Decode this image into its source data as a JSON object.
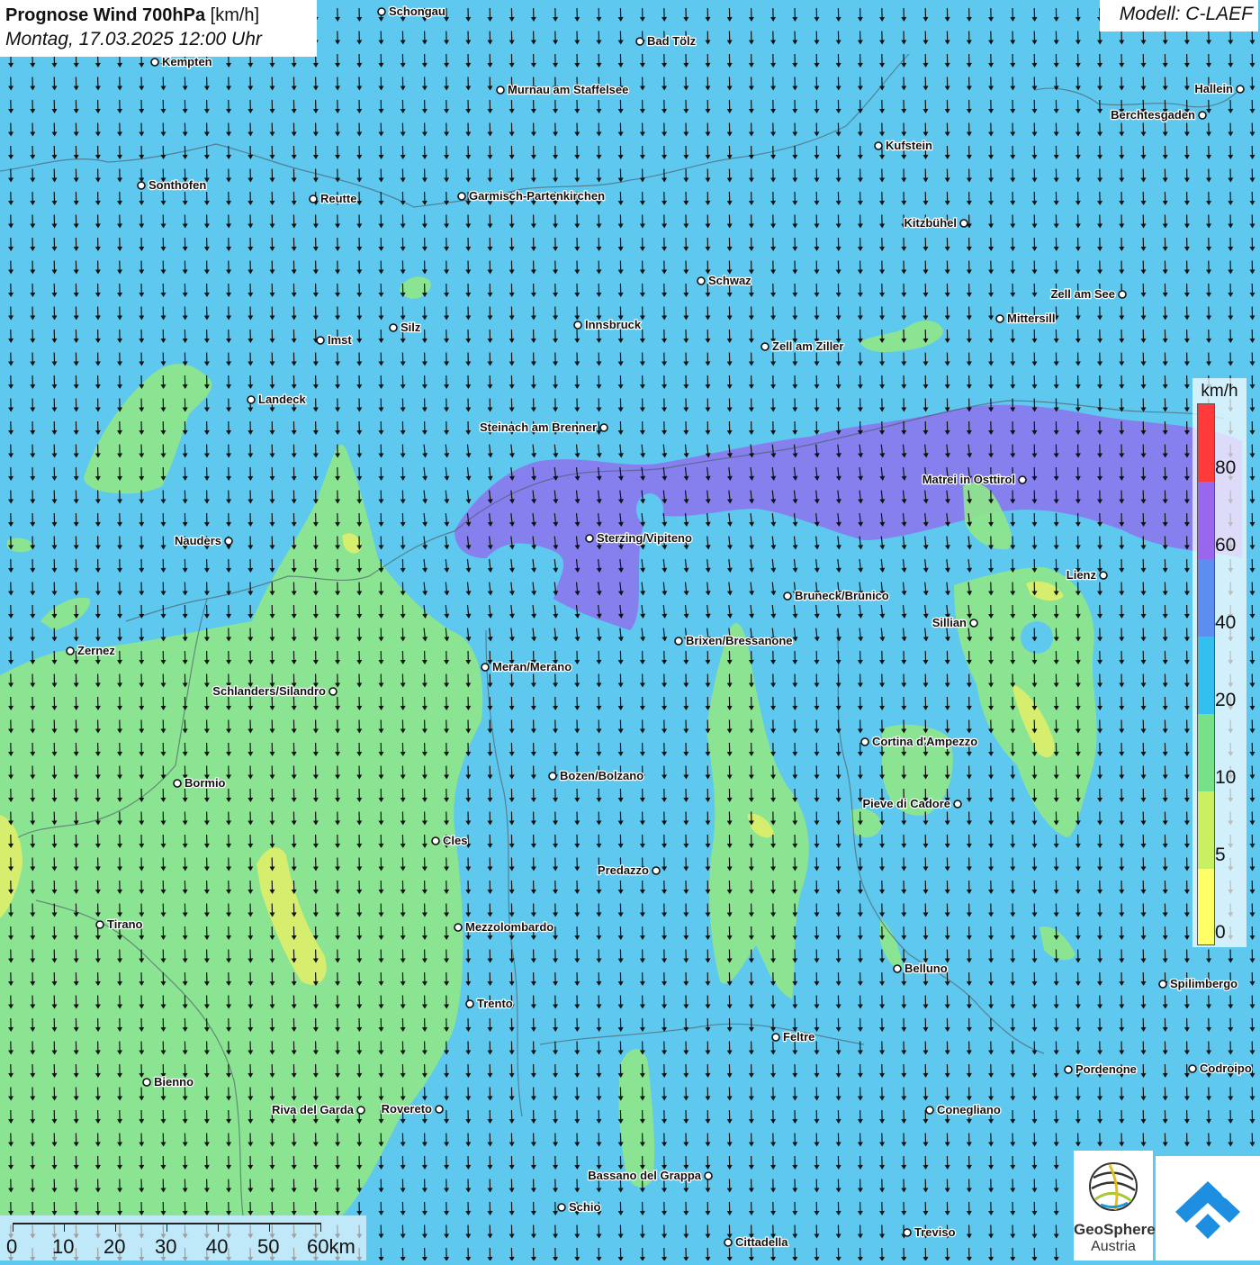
{
  "title": {
    "main": "Prognose Wind 700hPa",
    "unit": "[km/h]",
    "datetime": "Montag, 17.03.2025 12:00 Uhr"
  },
  "model": "Modell: C-LAEF",
  "legend": {
    "unit": "km/h",
    "labels": [
      "80",
      "60",
      "40",
      "20",
      "10",
      "5",
      "0"
    ],
    "colors": [
      "#ff3a3a",
      "#9966ee",
      "#5b8ef0",
      "#33c0ee",
      "#77e088",
      "#c8f060",
      "#ffff66"
    ]
  },
  "scale": {
    "labels": [
      "0",
      "10",
      "20",
      "30",
      "40",
      "50",
      "60km"
    ]
  },
  "logos": {
    "brand": "GeoSphere",
    "brand_sub": "Austria"
  },
  "cities": [
    {
      "name": "Schongau"
    },
    {
      "name": "Bad Tölz"
    },
    {
      "name": "Kempten"
    },
    {
      "name": "Murnau am Staffelsee"
    },
    {
      "name": "Hallein"
    },
    {
      "name": "Berchtesgaden"
    },
    {
      "name": "Kufstein"
    },
    {
      "name": "Sonthofen"
    },
    {
      "name": "Reutte"
    },
    {
      "name": "Garmisch-Partenkirchen"
    },
    {
      "name": "Kitzbühel"
    },
    {
      "name": "Schwaz"
    },
    {
      "name": "Zell am See"
    },
    {
      "name": "Mittersill"
    },
    {
      "name": "Innsbruck"
    },
    {
      "name": "Silz"
    },
    {
      "name": "Imst"
    },
    {
      "name": "Zell am Ziller"
    },
    {
      "name": "Landeck"
    },
    {
      "name": "Steinach am Brenner"
    },
    {
      "name": "Matrei in Osttirol"
    },
    {
      "name": "Nauders"
    },
    {
      "name": "Sterzing/Vipiteno"
    },
    {
      "name": "Lienz"
    },
    {
      "name": "Bruneck/Brunico"
    },
    {
      "name": "Sillian"
    },
    {
      "name": "Brixen/Bressanone"
    },
    {
      "name": "Zernez"
    },
    {
      "name": "Meran/Merano"
    },
    {
      "name": "Schlanders/Silandro"
    },
    {
      "name": "Cortina d'Ampezzo"
    },
    {
      "name": "Bozen/Bolzano"
    },
    {
      "name": "Bormio"
    },
    {
      "name": "Pieve di Cadore"
    },
    {
      "name": "Cles"
    },
    {
      "name": "Predazzo"
    },
    {
      "name": "Tirano"
    },
    {
      "name": "Mezzolombardo"
    },
    {
      "name": "Belluno"
    },
    {
      "name": "Spilimbergo"
    },
    {
      "name": "Trento"
    },
    {
      "name": "Feltre"
    },
    {
      "name": "Pordenone"
    },
    {
      "name": "Codroipo"
    },
    {
      "name": "Bienno"
    },
    {
      "name": "Riva del Garda"
    },
    {
      "name": "Rovereto"
    },
    {
      "name": "Conegliano"
    },
    {
      "name": "Bassano del Grappa"
    },
    {
      "name": "Schio"
    },
    {
      "name": "Cittadella"
    },
    {
      "name": "Treviso"
    }
  ]
}
